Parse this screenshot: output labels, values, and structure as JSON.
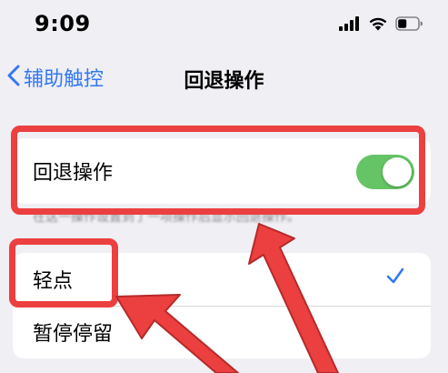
{
  "status_bar": {
    "time": "9:09",
    "signal_icon": "cellular-signal-icon",
    "wifi_icon": "wifi-icon",
    "battery_icon": "battery-icon"
  },
  "nav": {
    "back_label": "辅助触控",
    "back_icon": "chevron-left-icon",
    "title": "回退操作"
  },
  "toggle_group": {
    "label": "回退操作",
    "toggle_on": true,
    "footer": "在这一操作设置到了一项操作后显示回退操作。"
  },
  "options_group": {
    "items": [
      {
        "label": "轻点",
        "selected": true
      },
      {
        "label": "暂停停留",
        "selected": false
      }
    ],
    "check_icon": "checkmark-icon"
  },
  "colors": {
    "accent": "#3478f6",
    "toggle_on": "#65c466",
    "annotation": "#ec3f3f",
    "background": "#efeff4"
  }
}
